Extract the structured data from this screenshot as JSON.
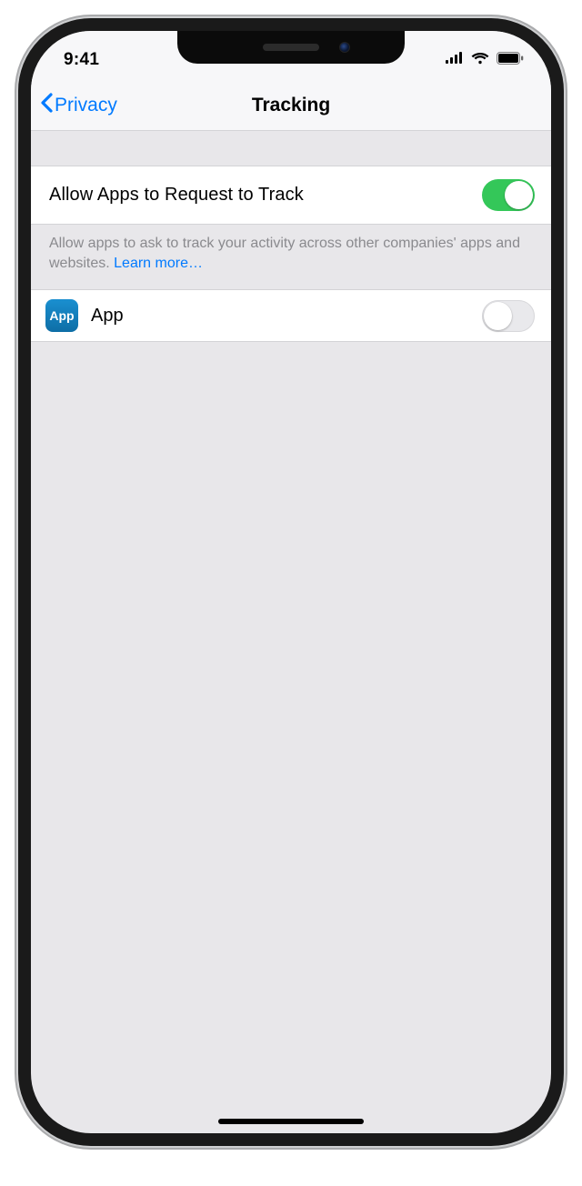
{
  "statusBar": {
    "time": "9:41"
  },
  "nav": {
    "backLabel": "Privacy",
    "title": "Tracking"
  },
  "sections": {
    "allow": {
      "label": "Allow Apps to Request to Track",
      "enabled": true,
      "footerText": "Allow apps to ask to track your activity across other companies' apps and websites. ",
      "footerLink": "Learn more…"
    }
  },
  "appList": [
    {
      "iconLabel": "App",
      "name": "App",
      "enabled": false
    }
  ]
}
